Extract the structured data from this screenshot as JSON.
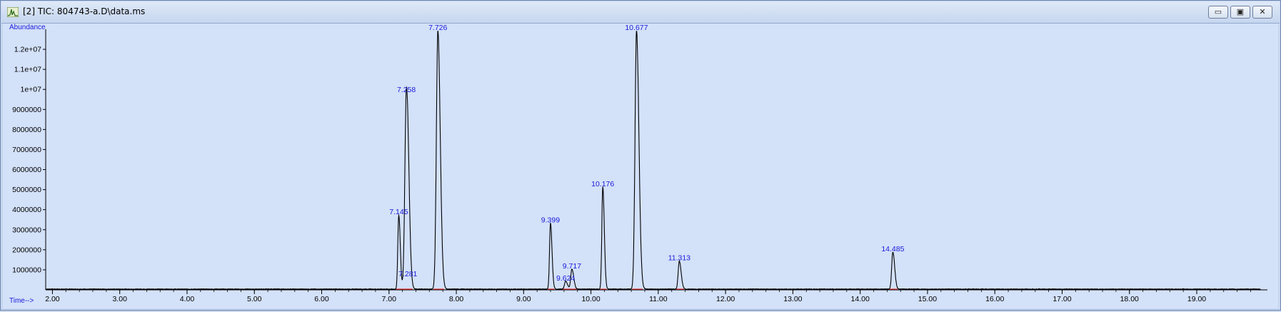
{
  "window": {
    "title": "[2] TIC: 804743-a.D\\data.ms",
    "buttons": {
      "minimize": "▭",
      "restore": "▣",
      "close": "✕"
    }
  },
  "colors": {
    "trace": "#000000",
    "labels": "#1a1ad8",
    "baseline": "#e03030",
    "background": "#d3e1f9"
  },
  "chart_data": {
    "type": "line",
    "ylabel": "Abundance",
    "xlabel": "Time-->",
    "xlim": [
      1.9,
      20.05
    ],
    "ylim": [
      0,
      13000000
    ],
    "xticks": [
      2.0,
      3.0,
      4.0,
      5.0,
      6.0,
      7.0,
      8.0,
      9.0,
      10.0,
      11.0,
      12.0,
      13.0,
      14.0,
      15.0,
      16.0,
      17.0,
      18.0,
      19.0
    ],
    "xtick_labels": [
      "2.00",
      "3.00",
      "4.00",
      "5.00",
      "6.00",
      "7.00",
      "8.00",
      "9.00",
      "10.00",
      "11.00",
      "12.00",
      "13.00",
      "14.00",
      "15.00",
      "16.00",
      "17.00",
      "18.00",
      "19.00"
    ],
    "yticks": [
      1000000,
      2000000,
      3000000,
      4000000,
      5000000,
      6000000,
      7000000,
      8000000,
      9000000,
      10000000,
      11000000,
      12000000
    ],
    "ytick_labels": [
      "1000000",
      "2000000",
      "3000000",
      "4000000",
      "5000000",
      "6000000",
      "7000000",
      "8000000",
      "9000000",
      "1e+07",
      "1.1e+07",
      "1.2e+07"
    ],
    "peaks": [
      {
        "rt": 7.145,
        "label": "7.145",
        "height": 3700000
      },
      {
        "rt": 7.258,
        "label": "7.258",
        "height": 9800000
      },
      {
        "rt": 7.281,
        "label": "7.281",
        "height": 600000
      },
      {
        "rt": 7.726,
        "label": "7.726",
        "height": 12900000
      },
      {
        "rt": 9.399,
        "label": "9.399",
        "height": 3300000
      },
      {
        "rt": 9.624,
        "label": "9.624",
        "height": 400000
      },
      {
        "rt": 9.717,
        "label": "9.717",
        "height": 1000000
      },
      {
        "rt": 10.176,
        "label": "10.176",
        "height": 5100000
      },
      {
        "rt": 10.677,
        "label": "10.677",
        "height": 12900000
      },
      {
        "rt": 11.313,
        "label": "11.313",
        "height": 1400000
      },
      {
        "rt": 14.485,
        "label": "14.485",
        "height": 1850000
      }
    ]
  }
}
